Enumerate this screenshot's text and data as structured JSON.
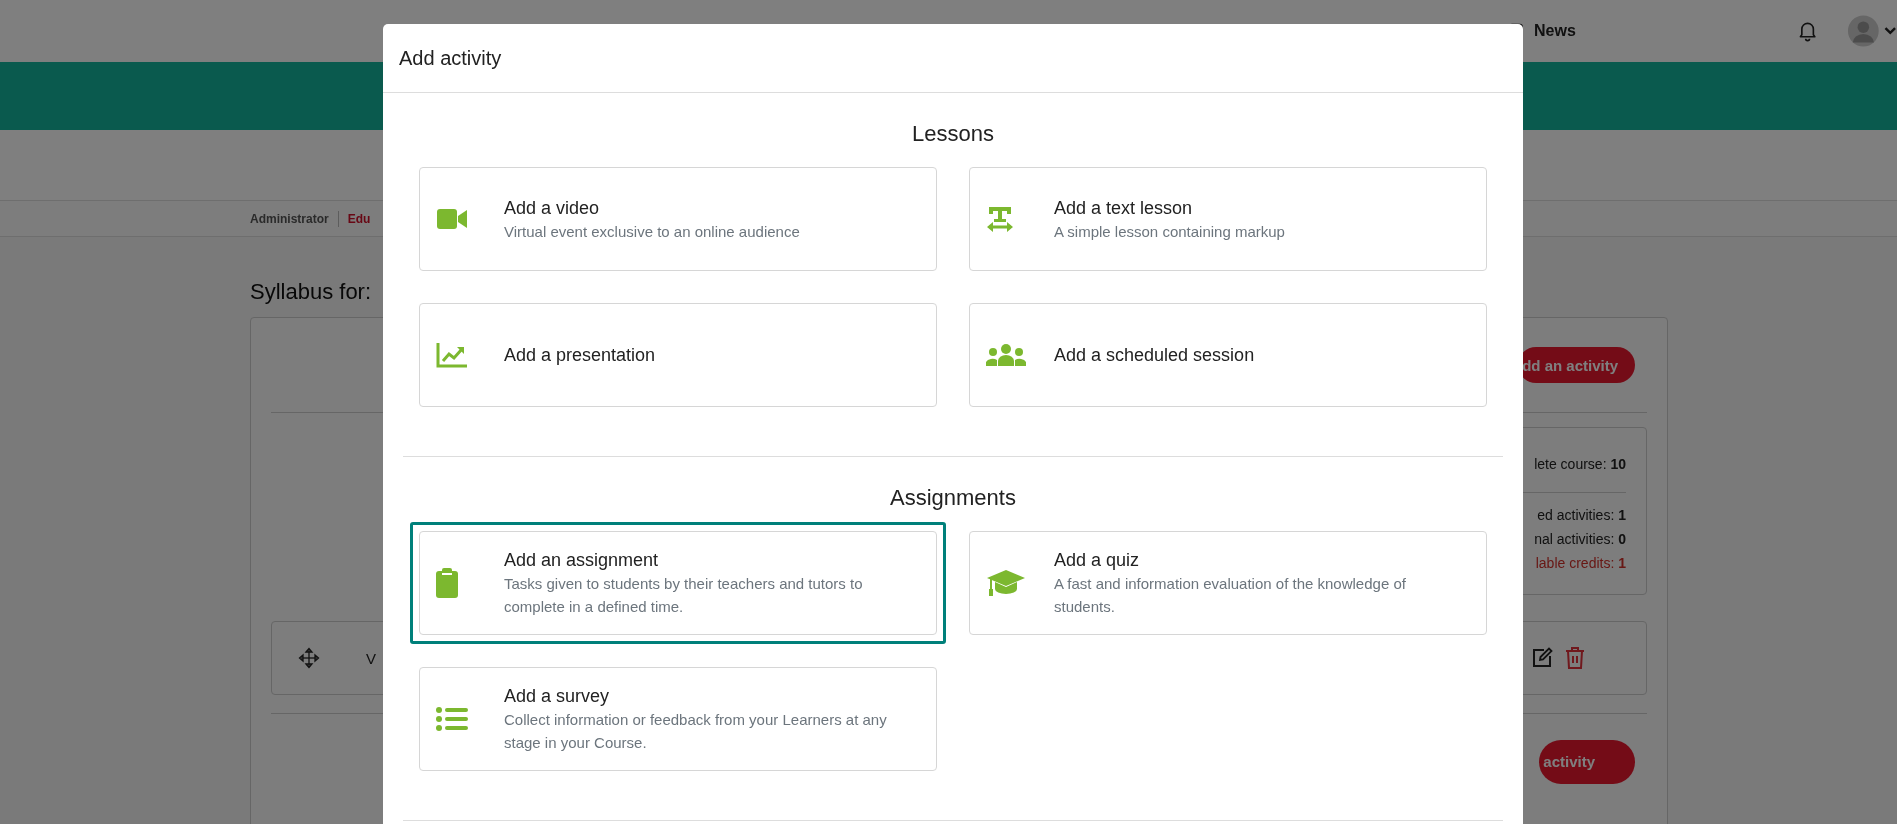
{
  "navbar": {
    "news_label": "News"
  },
  "breadcrumb": [
    {
      "label": "Administrator",
      "kind": "plain"
    },
    {
      "label": "Edu",
      "kind": "link"
    }
  ],
  "syllabus": {
    "title": "Syllabus for:",
    "add_button": "dd an activity",
    "stats": [
      {
        "label": "lete course:",
        "value": "10",
        "kind": "total"
      },
      {
        "label": "ed activities:",
        "value": "1",
        "kind": "plain"
      },
      {
        "label": "nal activities:",
        "value": "0",
        "kind": "plain"
      },
      {
        "label": "lable credits:",
        "value": "1",
        "kind": "alert"
      }
    ],
    "activity_row": {
      "title": "V"
    },
    "bottom_button": "activity"
  },
  "modal": {
    "title": "Add activity",
    "sections": [
      {
        "heading": "Lessons",
        "options": [
          {
            "kind": "video",
            "title": "Add a video",
            "description": "Virtual event exclusive to an online audience",
            "selected": false
          },
          {
            "kind": "text",
            "title": "Add a text lesson",
            "description": "A simple lesson containing markup",
            "selected": false
          },
          {
            "kind": "presentation",
            "title": "Add a presentation",
            "selected": false
          },
          {
            "kind": "session",
            "title": "Add a scheduled session",
            "selected": false
          }
        ]
      },
      {
        "heading": "Assignments",
        "options": [
          {
            "kind": "assignment",
            "title": "Add an assignment",
            "description": "Tasks given to students by their teachers and tutors to complete in a defined time.",
            "selected": true
          },
          {
            "kind": "quiz",
            "title": "Add a quiz",
            "description": "A fast and information evaluation of the knowledge of students.",
            "selected": false
          },
          {
            "kind": "survey",
            "title": "Add a survey",
            "description": "Collect information or feedback from your Learners at any stage in your Course.",
            "selected": false
          }
        ]
      }
    ]
  }
}
